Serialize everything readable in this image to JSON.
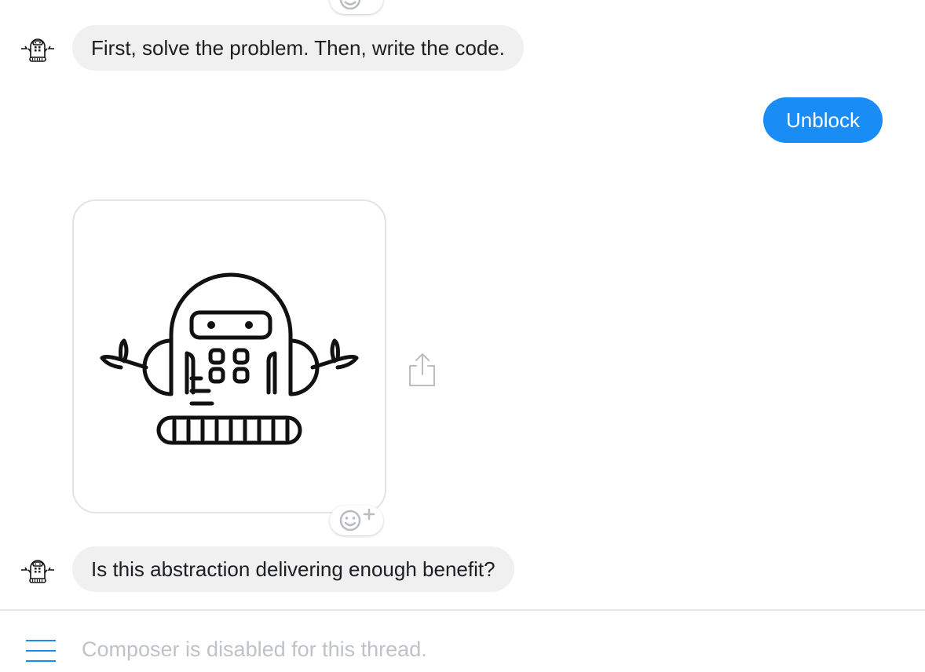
{
  "messages": [
    {
      "sender": "bot",
      "text": "First, solve the problem. Then, write the code."
    },
    {
      "sender": "bot",
      "text": "Is this abstraction delivering enough benefit?"
    }
  ],
  "actions": {
    "unblock_label": "Unblock"
  },
  "sticker": {
    "icon": "robot-sticker-icon"
  },
  "composer": {
    "disabled_text": "Composer is disabled for this thread."
  },
  "colors": {
    "accent": "#1a8cf5",
    "bubble_bg": "#f0f0f0",
    "placeholder": "#bec3c9"
  }
}
